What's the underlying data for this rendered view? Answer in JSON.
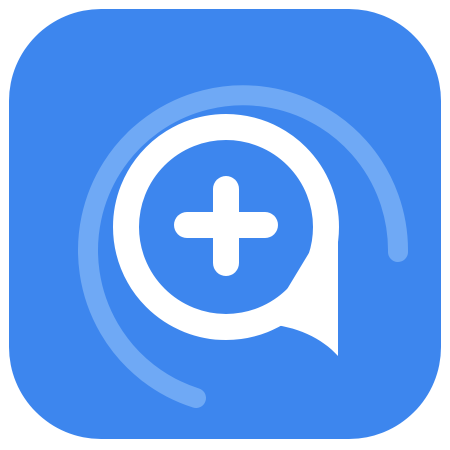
{
  "app_icon": {
    "icon_name": "add-chat-icon",
    "colors": {
      "background": "#3D86EE",
      "ring": "#6FA9F5",
      "glyph": "#FFFFFF",
      "plus": "#FFFFFF"
    }
  }
}
